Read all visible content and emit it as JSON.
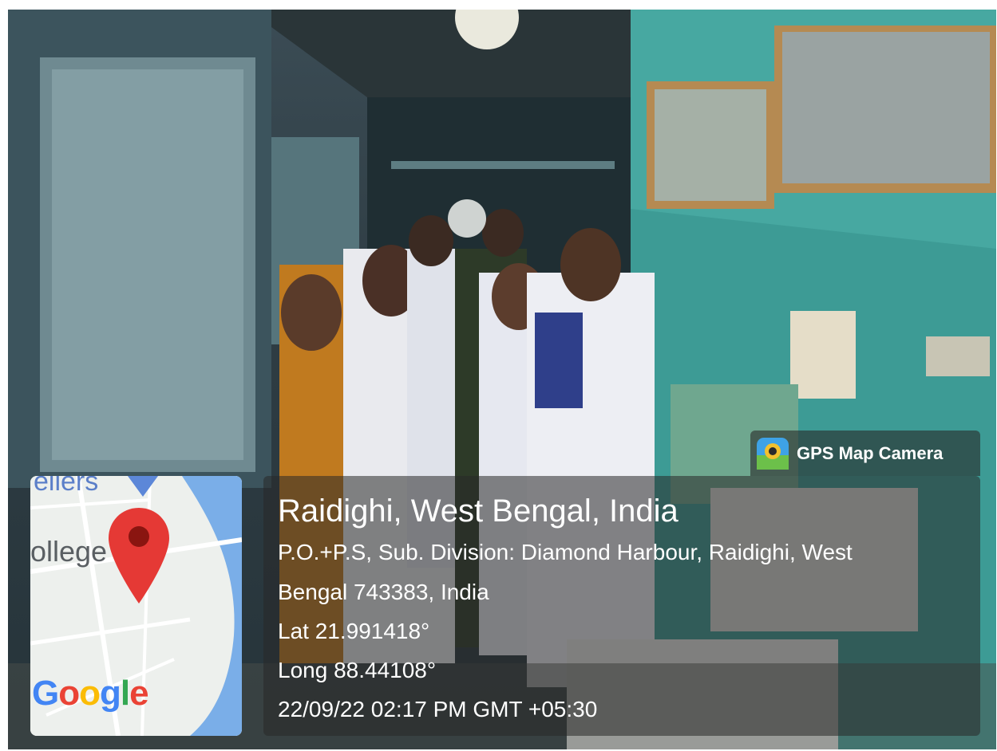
{
  "badge": {
    "text": "GPS Map Camera",
    "icon": "map-pin-camera-icon"
  },
  "location": {
    "place": "Raidighi, West Bengal, India",
    "address_line1": "P.O.+P.S, Sub. Division: Diamond Harbour, Raidighi, West",
    "address_line2": "Bengal 743383, India",
    "lat": "Lat 21.991418°",
    "long": "Long 88.44108°",
    "datetime": "22/09/22 02:17 PM GMT +05:30"
  },
  "map": {
    "label_top": "ellers",
    "label_left": "ollege",
    "brand": "Google",
    "colors": {
      "pin": "#e53935",
      "water": "#7aaee8",
      "road": "#ffffff"
    }
  }
}
